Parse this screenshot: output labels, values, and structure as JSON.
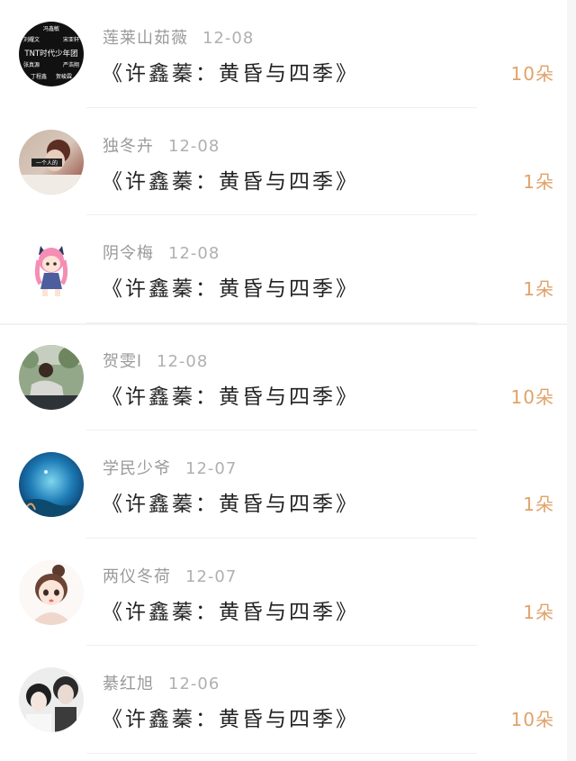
{
  "rows": [
    {
      "user": "莲莱山茹薇",
      "date": "12-08",
      "title": "《许鑫蓁：黄昏与四季》",
      "count": "10朵",
      "avatar": "tnt-text-avatar"
    },
    {
      "user": "独冬卉",
      "date": "12-08",
      "title": "《许鑫蓁：黄昏与四季》",
      "count": "1朵",
      "avatar": "photo-avatar"
    },
    {
      "user": "阴令梅",
      "date": "12-08",
      "title": "《许鑫蓁：黄昏与四季》",
      "count": "1朵",
      "avatar": "anime-girl-avatar"
    },
    {
      "user": "贺雯l",
      "date": "12-08",
      "title": "《许鑫蓁：黄昏与四季》",
      "count": "10朵",
      "avatar": "outdoor-photo-avatar"
    },
    {
      "user": "学民少爷",
      "date": "12-07",
      "title": "《许鑫蓁：黄昏与四季》",
      "count": "1朵",
      "avatar": "ocean-avatar"
    },
    {
      "user": "两仪冬荷",
      "date": "12-07",
      "title": "《许鑫蓁：黄昏与四季》",
      "count": "1朵",
      "avatar": "doll-avatar"
    },
    {
      "user": "綦红旭",
      "date": "12-06",
      "title": "《许鑫蓁：黄昏与四季》",
      "count": "10朵",
      "avatar": "couple-avatar"
    }
  ],
  "avatar0_lines": [
    "冯鑫敏",
    "刘耀文",
    "宋亚轩",
    "TNT时代少年团",
    "张真源",
    "严浩翔",
    "丁程鑫",
    "贺峻霖"
  ],
  "avatar1_text": "一个人的",
  "colors": {
    "count": "#e0a26a",
    "title": "#222222",
    "meta": "#9a9a9a"
  }
}
